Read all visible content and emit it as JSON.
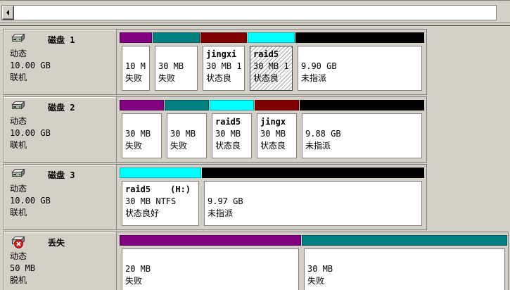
{
  "scrollbar": {
    "left_arrow_icon": "left-arrow-icon"
  },
  "disks": [
    {
      "icon": "disk-icon",
      "title": "磁盘 1",
      "type": "动态",
      "capacity": "10.00 GB",
      "status": "联机",
      "volumes": [
        {
          "size": "10 M",
          "status": "失败",
          "color": "#800080"
        },
        {
          "size": "30 MB",
          "status": "失败",
          "color": "#008080"
        },
        {
          "name": "jingxi",
          "size": "30 MB 1",
          "status": "状态良",
          "color": "#800000"
        },
        {
          "name": "raid5",
          "size": "30 MB 1",
          "status": "状态良",
          "color": "#00ffff",
          "selected": true
        },
        {
          "size": "9.90 GB",
          "status": "未指派",
          "color": "#000000"
        }
      ]
    },
    {
      "icon": "disk-icon",
      "title": "磁盘 2",
      "type": "动态",
      "capacity": "10.00 GB",
      "status": "联机",
      "volumes": [
        {
          "size": "30 MB",
          "status": "失败",
          "color": "#800080"
        },
        {
          "size": "30 MB",
          "status": "失败",
          "color": "#008080"
        },
        {
          "name": "raid5",
          "size": "30 MB",
          "status": "状态良",
          "color": "#00ffff"
        },
        {
          "name": "jingx",
          "size": "30 MB",
          "status": "状态良",
          "color": "#800000"
        },
        {
          "size": "9.88 GB",
          "status": "未指派",
          "color": "#000000"
        }
      ]
    },
    {
      "icon": "disk-icon",
      "title": "磁盘 3",
      "type": "动态",
      "capacity": "10.00 GB",
      "status": "联机",
      "volumes": [
        {
          "name": "raid5",
          "drive": "(H:)",
          "size": "30 MB NTFS",
          "status": "状态良好",
          "color": "#00ffff"
        },
        {
          "size": "9.97 GB",
          "status": "未指派",
          "color": "#000000"
        }
      ]
    },
    {
      "icon": "missing-disk-icon",
      "title": "丢失",
      "type": "动态",
      "capacity": "50 MB",
      "status": "脱机",
      "volumes": [
        {
          "size": "20 MB",
          "status": "失败",
          "color": "#800080"
        },
        {
          "size": "30 MB",
          "status": "失败",
          "color": "#008080"
        }
      ]
    }
  ]
}
